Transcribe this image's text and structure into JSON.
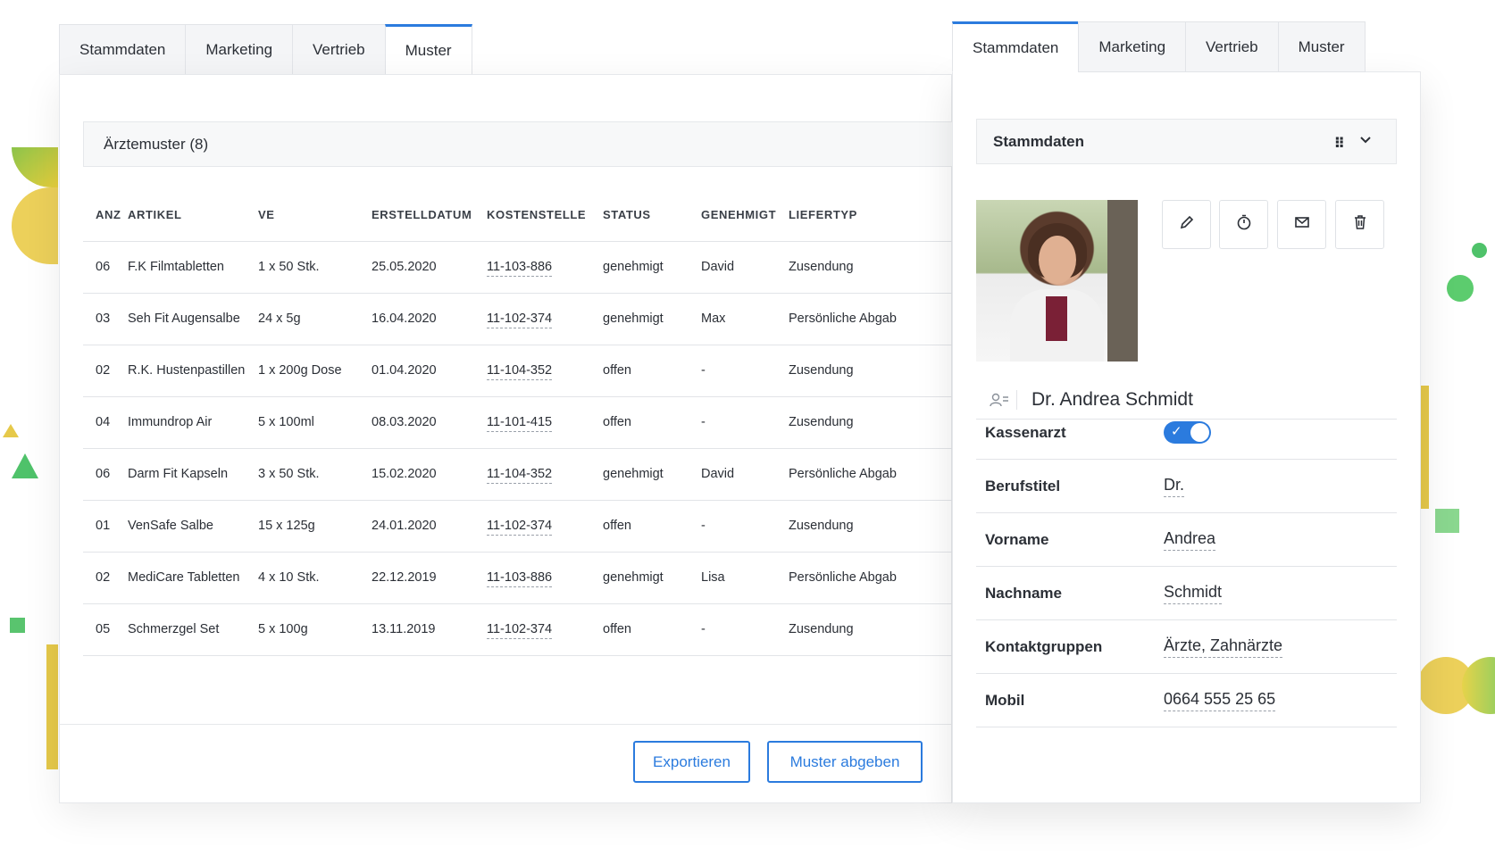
{
  "left": {
    "tabs": [
      {
        "label": "Stammdaten",
        "active": false
      },
      {
        "label": "Marketing",
        "active": false
      },
      {
        "label": "Vertrieb",
        "active": false
      },
      {
        "label": "Muster",
        "active": true
      }
    ],
    "section_title": "Ärztemuster (8)",
    "columns": [
      "ANZ",
      "ARTIKEL",
      "VE",
      "ERSTELLDATUM",
      "KOSTENSTELLE",
      "STATUS",
      "GENEHMIGT",
      "LIEFERTYP"
    ],
    "rows": [
      [
        "06",
        "F.K Filmtabletten",
        "1 x 50 Stk.",
        "25.05.2020",
        "11-103-886",
        "genehmigt",
        "David",
        "Zusendung"
      ],
      [
        "03",
        "Seh Fit Augensalbe",
        "24 x 5g",
        "16.04.2020",
        "11-102-374",
        "genehmigt",
        "Max",
        "Persönliche Abgab"
      ],
      [
        "02",
        "R.K. Hustenpastillen",
        "1 x 200g Dose",
        "01.04.2020",
        "11-104-352",
        "offen",
        "-",
        "Zusendung"
      ],
      [
        "04",
        "Immundrop Air",
        "5 x 100ml",
        "08.03.2020",
        "11-101-415",
        "offen",
        "-",
        "Zusendung"
      ],
      [
        "06",
        "Darm Fit Kapseln",
        "3 x 50 Stk.",
        "15.02.2020",
        "11-104-352",
        "genehmigt",
        "David",
        "Persönliche Abgab"
      ],
      [
        "01",
        "VenSafe Salbe",
        "15 x 125g",
        "24.01.2020",
        "11-102-374",
        "offen",
        "-",
        "Zusendung"
      ],
      [
        "02",
        "MediCare Tabletten",
        "4 x 10 Stk.",
        "22.12.2019",
        "11-103-886",
        "genehmigt",
        "Lisa",
        "Persönliche Abgab"
      ],
      [
        "05",
        "Schmerzgel Set",
        "5 x 100g",
        "13.11.2019",
        "11-102-374",
        "offen",
        "-",
        "Zusendung"
      ]
    ],
    "buttons": {
      "export": "Exportieren",
      "submit": "Muster abgeben"
    }
  },
  "right": {
    "tabs": [
      {
        "label": "Stammdaten",
        "active": true
      },
      {
        "label": "Marketing",
        "active": false
      },
      {
        "label": "Vertrieb",
        "active": false
      },
      {
        "label": "Muster",
        "active": false
      }
    ],
    "section_title": "Stammdaten",
    "icons": [
      "pencil-icon",
      "timer-icon",
      "mail-icon",
      "trash-icon",
      "grip-icon",
      "chevron-down-icon",
      "contact-card-icon"
    ],
    "accent_color": "#2b7bde",
    "display_name": "Dr. Andrea Schmidt",
    "fields": {
      "kassenarzt_label": "Kassenarzt",
      "kassenarzt_value": true,
      "berufstitel_label": "Berufstitel",
      "berufstitel_value": "Dr.",
      "vorname_label": "Vorname",
      "vorname_value": "Andrea",
      "nachname_label": "Nachname",
      "nachname_value": "Schmidt",
      "kontaktgruppen_label": "Kontaktgruppen",
      "kontaktgruppen_value": "Ärzte, Zahnärzte",
      "mobil_label": "Mobil",
      "mobil_value": "0664 555 25 65"
    }
  }
}
